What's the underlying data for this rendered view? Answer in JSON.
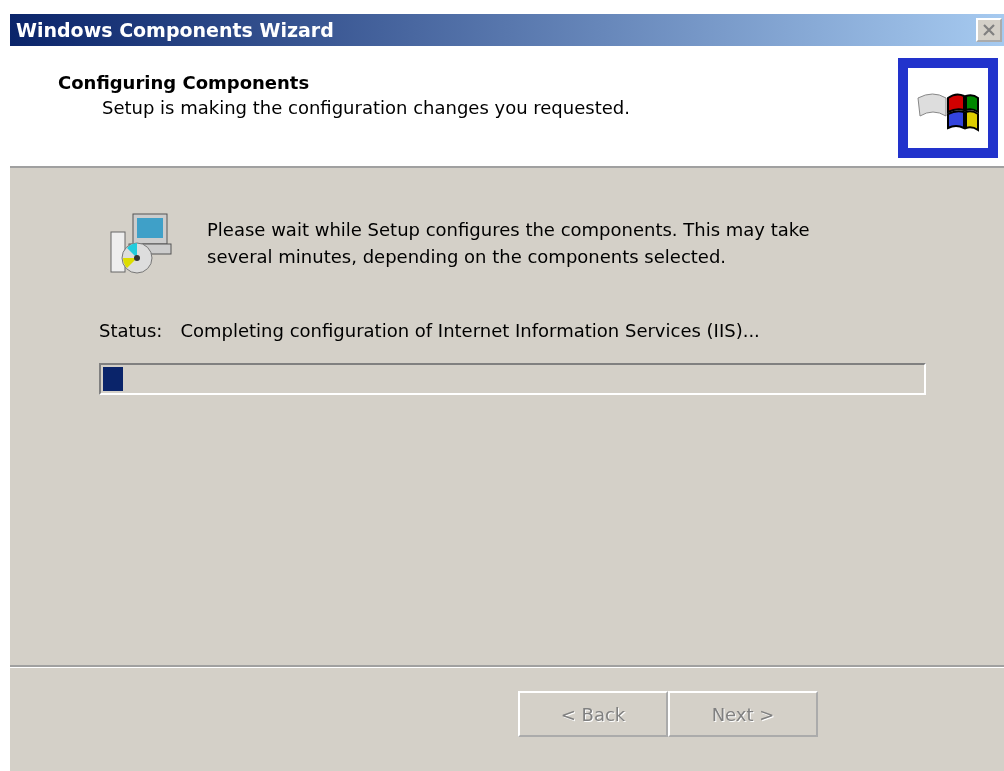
{
  "window": {
    "title": "Windows Components Wizard",
    "close_disabled": true
  },
  "header": {
    "title": "Configuring Components",
    "subtitle": "Setup is making the configuration changes you requested."
  },
  "message": "Please wait while Setup configures the components. This may take several minutes, depending on the components selected.",
  "status": {
    "label": "Status:",
    "value": "Completing configuration of Internet Information Services (IIS)..."
  },
  "progress": {
    "level": 0.025
  },
  "buttons": [
    {
      "label": "< Back",
      "disabled": true
    },
    {
      "label": "Next >",
      "disabled": true
    }
  ]
}
